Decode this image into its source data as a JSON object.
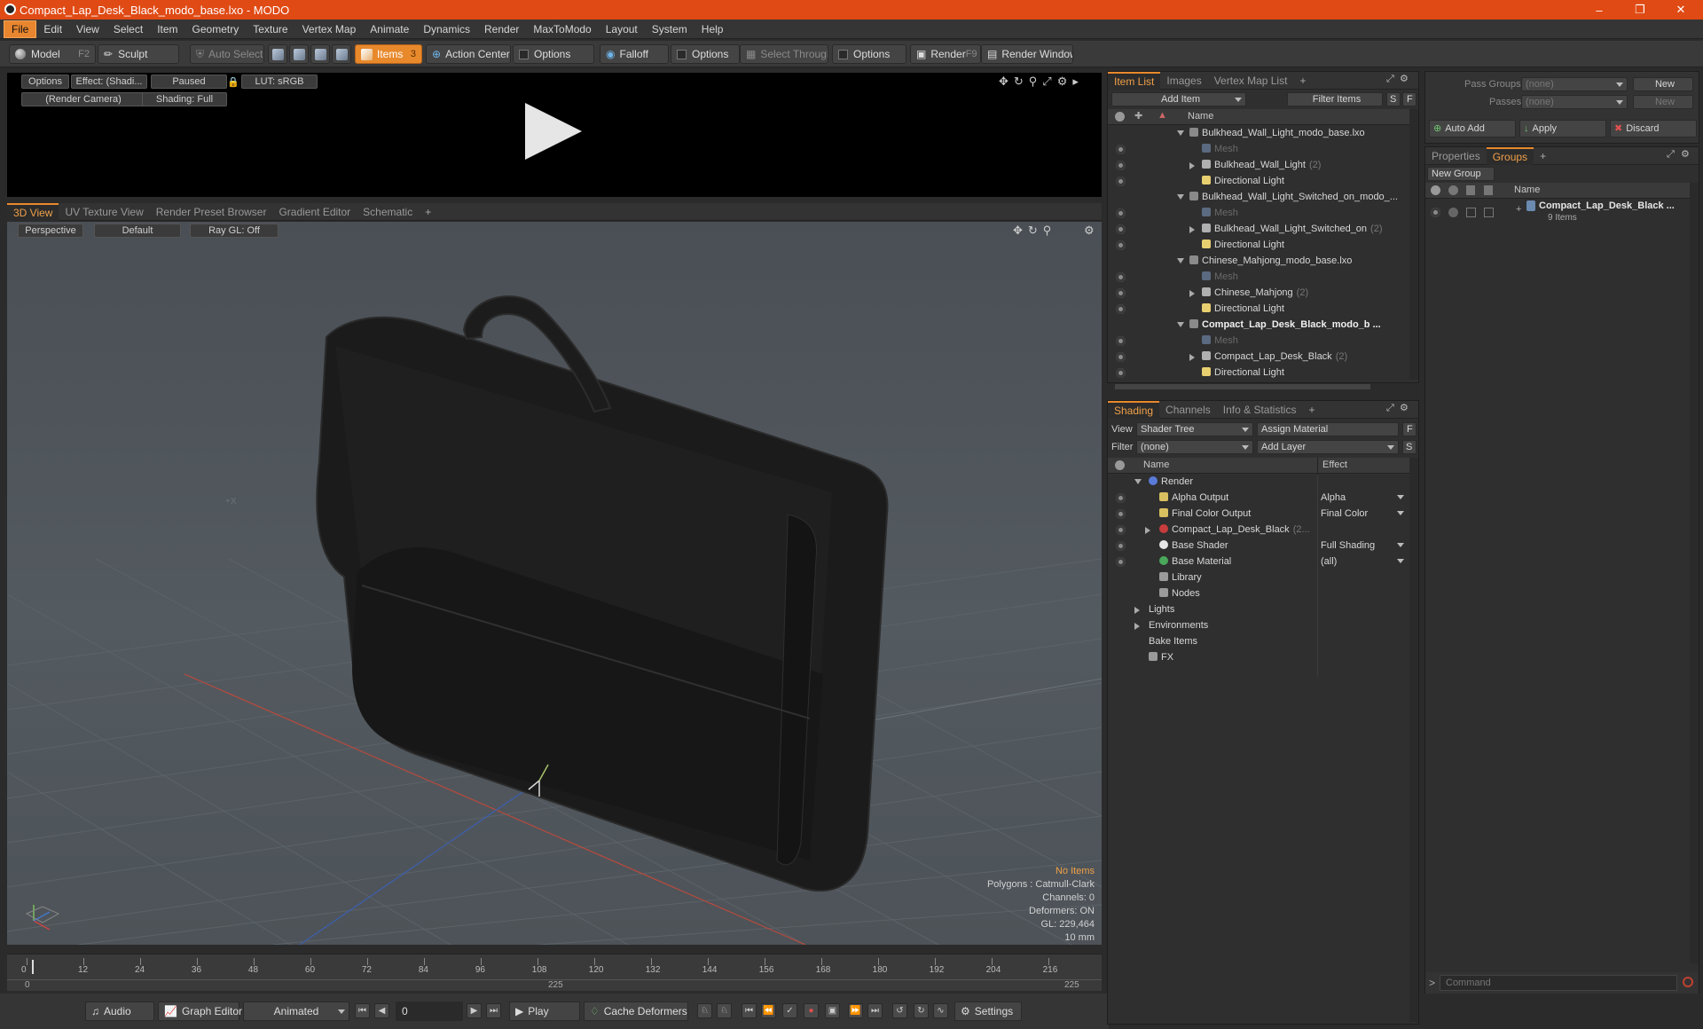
{
  "window": {
    "title": "Compact_Lap_Desk_Black_modo_base.lxo - MODO"
  },
  "menu": [
    "File",
    "Edit",
    "View",
    "Select",
    "Item",
    "Geometry",
    "Texture",
    "Vertex Map",
    "Animate",
    "Dynamics",
    "Render",
    "MaxToModo",
    "Layout",
    "System",
    "Help"
  ],
  "toolbar": {
    "model": "Model",
    "model_key": "F2",
    "sculpt": "Sculpt",
    "auto_select": "Auto Select",
    "items": "Items",
    "items_key": "3",
    "action_center": "Action Center",
    "options1": "Options",
    "falloff": "Falloff",
    "options2": "Options",
    "select_through": "Select Through",
    "options3": "Options",
    "render": "Render",
    "render_key": "F9",
    "render_window": "Render Window"
  },
  "preview": {
    "options": "Options",
    "effect": "Effect: (Shadi...",
    "paused": "Paused",
    "lut": "LUT: sRGB",
    "camera": "(Render Camera)",
    "shading": "Shading: Full"
  },
  "view_tabs": [
    "3D View",
    "UV Texture View",
    "Render Preset Browser",
    "Gradient Editor",
    "Schematic"
  ],
  "viewport": {
    "perspective": "Perspective",
    "default": "Default",
    "raygl": "Ray GL: Off",
    "info": [
      "No Items",
      "Polygons : Catmull-Clark",
      "Channels: 0",
      "Deformers: ON",
      "GL: 229,464",
      "10 mm"
    ]
  },
  "timeline": {
    "ticks": [
      "0",
      "12",
      "24",
      "36",
      "48",
      "60",
      "72",
      "84",
      "96",
      "108",
      "120",
      "132",
      "144",
      "156",
      "168",
      "180",
      "192",
      "204",
      "216"
    ],
    "sub_start": "0",
    "sub_mid": "225",
    "sub_end": "225"
  },
  "bottombar": {
    "audio": "Audio",
    "graph_editor": "Graph Editor",
    "animated": "Animated",
    "frame": "0",
    "play": "Play",
    "cache_deformers": "Cache Deformers",
    "settings": "Settings"
  },
  "item_list": {
    "tabs": [
      "Item List",
      "Images",
      "Vertex Map List"
    ],
    "add_item": "Add Item",
    "filter_items": "Filter Items",
    "s": "S",
    "f": "F",
    "col_name": "Name",
    "rows": [
      {
        "label": "Bulkhead_Wall_Light_modo_base.lxo",
        "level": 0,
        "kind": "scene",
        "expanded": true
      },
      {
        "label": "Mesh",
        "level": 1,
        "kind": "mesh-dim"
      },
      {
        "label": "Bulkhead_Wall_Light",
        "count": "(2)",
        "level": 1,
        "kind": "group",
        "collapsed": true
      },
      {
        "label": "Directional Light",
        "level": 1,
        "kind": "light"
      },
      {
        "label": "Bulkhead_Wall_Light_Switched_on_modo_...",
        "level": 0,
        "kind": "scene",
        "expanded": true
      },
      {
        "label": "Mesh",
        "level": 1,
        "kind": "mesh-dim"
      },
      {
        "label": "Bulkhead_Wall_Light_Switched_on",
        "count": "(2)",
        "level": 1,
        "kind": "group",
        "collapsed": true
      },
      {
        "label": "Directional Light",
        "level": 1,
        "kind": "light"
      },
      {
        "label": "Chinese_Mahjong_modo_base.lxo",
        "level": 0,
        "kind": "scene",
        "expanded": true
      },
      {
        "label": "Mesh",
        "level": 1,
        "kind": "mesh-dim"
      },
      {
        "label": "Chinese_Mahjong",
        "count": "(2)",
        "level": 1,
        "kind": "group",
        "collapsed": true
      },
      {
        "label": "Directional Light",
        "level": 1,
        "kind": "light"
      },
      {
        "label": "Compact_Lap_Desk_Black_modo_b ...",
        "level": 0,
        "kind": "scene",
        "expanded": true,
        "bold": true
      },
      {
        "label": "Mesh",
        "level": 1,
        "kind": "mesh-dim"
      },
      {
        "label": "Compact_Lap_Desk_Black",
        "count": "(2)",
        "level": 1,
        "kind": "group",
        "collapsed": true
      },
      {
        "label": "Directional Light",
        "level": 1,
        "kind": "light"
      }
    ]
  },
  "shading": {
    "tabs": [
      "Shading",
      "Channels",
      "Info & Statistics"
    ],
    "view_label": "View",
    "view_value": "Shader Tree",
    "assign_material": "Assign Material",
    "f": "F",
    "filter_label": "Filter",
    "filter_value": "(none)",
    "add_layer": "Add Layer",
    "s": "S",
    "col_name": "Name",
    "col_effect": "Effect",
    "rows": [
      {
        "label": "Render",
        "effect": "",
        "level": 0,
        "kind": "render",
        "expanded": true
      },
      {
        "label": "Alpha Output",
        "effect": "Alpha",
        "level": 1,
        "kind": "output"
      },
      {
        "label": "Final Color Output",
        "effect": "Final Color",
        "level": 1,
        "kind": "output"
      },
      {
        "label": "Compact_Lap_Desk_Black",
        "count": "(2...",
        "effect": "",
        "level": 1,
        "kind": "material",
        "collapsed": true
      },
      {
        "label": "Base Shader",
        "effect": "Full Shading",
        "level": 1,
        "kind": "shader"
      },
      {
        "label": "Base Material",
        "effect": "(all)",
        "level": 1,
        "kind": "basemat"
      },
      {
        "label": "Library",
        "effect": "",
        "level": 1,
        "kind": "folder"
      },
      {
        "label": "Nodes",
        "effect": "",
        "level": 1,
        "kind": "folder"
      },
      {
        "label": "Lights",
        "effect": "",
        "level": 0,
        "kind": "plain",
        "collapsed": true
      },
      {
        "label": "Environments",
        "effect": "",
        "level": 0,
        "kind": "plain",
        "collapsed": true
      },
      {
        "label": "Bake Items",
        "effect": "",
        "level": 0,
        "kind": "plain"
      },
      {
        "label": "FX",
        "effect": "",
        "level": 0,
        "kind": "fx"
      }
    ]
  },
  "groups_panel": {
    "pass_groups_label": "Pass Groups",
    "pass_groups_value": "(none)",
    "new1": "New",
    "passes_label": "Passes",
    "passes_value": "(none)",
    "new2": "New",
    "auto_add": "Auto Add",
    "apply": "Apply",
    "discard": "Discard",
    "tabs": [
      "Properties",
      "Groups"
    ],
    "new_group": "New Group",
    "col_name": "Name",
    "group_name": "Compact_Lap_Desk_Black ...",
    "group_sub": "9 Items"
  },
  "command": {
    "placeholder": "Command"
  },
  "colors": {
    "accent": "#e8892c",
    "titlebar": "#e04a14"
  }
}
